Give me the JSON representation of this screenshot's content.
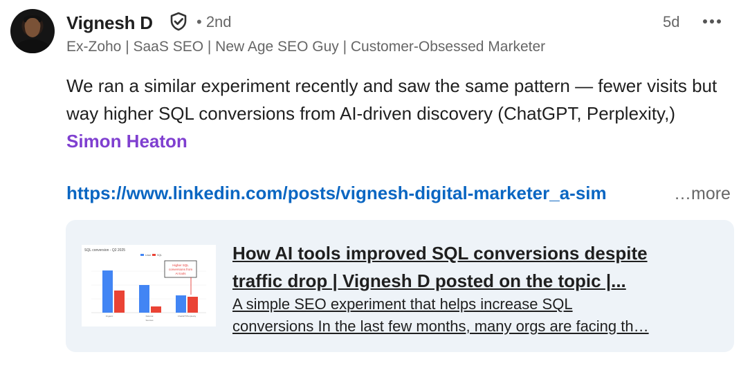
{
  "post": {
    "author": {
      "name": "Vignesh D",
      "degree": "• 2nd",
      "headline": "Ex-Zoho | SaaS SEO | New Age SEO Guy | Customer-Obsessed Marketer",
      "verified_icon": "shield-check-icon"
    },
    "time": "5d",
    "menu_icon": "more-horizontal-icon",
    "text": "We ran a similar experiment recently and saw the same pattern — fewer visits but way higher SQL conversions from AI-driven discovery (ChatGPT, Perplexity,) ",
    "mention": "Simon Heaton",
    "link": "https://www.linkedin.com/posts/vignesh-digital-marketer_a-sim",
    "see_more": "…more",
    "preview": {
      "title_line1": "How AI tools improved SQL conversions despite",
      "title_line2": "traffic drop | Vignesh D posted on the topic |...",
      "desc_line1": "A simple SEO experiment that helps increase SQL",
      "desc_line2": "conversions In the last few months, many orgs are facing th…",
      "thumbnail": {
        "chart_title": "SQL conversion - Q2 2025",
        "legend": [
          "Lead",
          "SQL"
        ],
        "annotation": "Higher SQL conversions from AI tools",
        "categories": [
          "Organic",
          "Referral",
          "ChatGPT/Perplexity"
        ],
        "x_label": "Sources",
        "colors": {
          "lead": "#4285f4",
          "sql": "#ea4335"
        }
      }
    }
  },
  "colors": {
    "link": "#0a66c2",
    "mention": "#7f3fd0",
    "muted": "#666666",
    "card_bg": "#eef3f8"
  }
}
